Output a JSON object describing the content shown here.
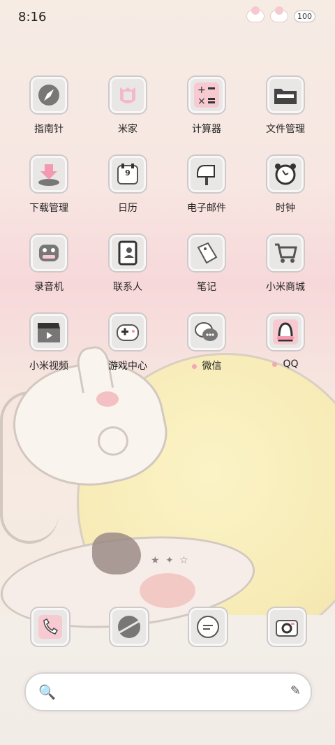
{
  "status": {
    "time": "8:16",
    "battery": "100"
  },
  "apps": [
    {
      "label": "指南针",
      "icon": "compass-icon",
      "dot": false
    },
    {
      "label": "米家",
      "icon": "mi-home-icon",
      "dot": false
    },
    {
      "label": "计算器",
      "icon": "calculator-icon",
      "dot": false
    },
    {
      "label": "文件管理",
      "icon": "folder-icon",
      "dot": false
    },
    {
      "label": "下载管理",
      "icon": "download-icon",
      "dot": false
    },
    {
      "label": "日历",
      "icon": "calendar-icon",
      "dot": false,
      "badge": "9"
    },
    {
      "label": "电子邮件",
      "icon": "mailbox-icon",
      "dot": false
    },
    {
      "label": "时钟",
      "icon": "alarm-clock-icon",
      "dot": false
    },
    {
      "label": "录音机",
      "icon": "recorder-icon",
      "dot": false
    },
    {
      "label": "联系人",
      "icon": "contacts-icon",
      "dot": false
    },
    {
      "label": "笔记",
      "icon": "tag-icon",
      "dot": false
    },
    {
      "label": "小米商城",
      "icon": "cart-icon",
      "dot": false
    },
    {
      "label": "小米视频",
      "icon": "clapper-icon",
      "dot": false
    },
    {
      "label": "游戏中心",
      "icon": "gamepad-icon",
      "dot": false
    },
    {
      "label": "微信",
      "icon": "chat-bubble-icon",
      "dot": true
    },
    {
      "label": "QQ",
      "icon": "penguin-icon",
      "dot": true
    }
  ],
  "dock": [
    {
      "icon": "phone-icon"
    },
    {
      "icon": "browser-icon"
    },
    {
      "icon": "message-icon"
    },
    {
      "icon": "camera-icon"
    }
  ],
  "page_indicator": "★ ✦ ☆",
  "search": {
    "placeholder": ""
  },
  "colors": {
    "accent_pink": "#f1a8b7",
    "icon_bg": "#e9e6e6"
  }
}
